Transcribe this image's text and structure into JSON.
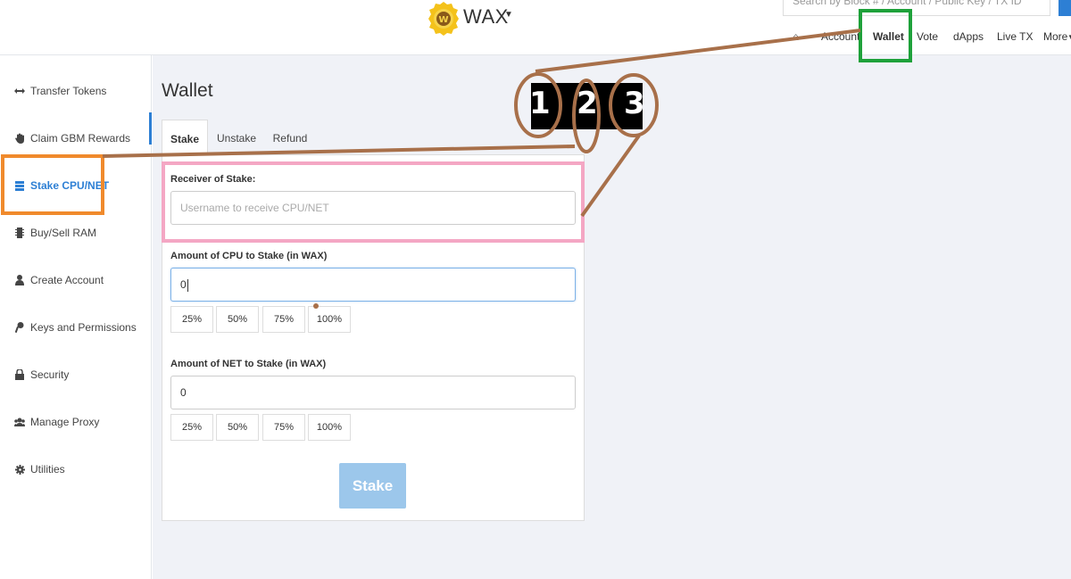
{
  "header": {
    "brand": "WAX",
    "search_placeholder": "Search by Block # / Account / Public Key / TX ID",
    "nav": {
      "account": "Account",
      "wallet": "Wallet",
      "vote": "Vote",
      "dapps": "dApps",
      "livetx": "Live TX",
      "more": "More"
    }
  },
  "sidebar": {
    "items": [
      {
        "label": "Transfer Tokens",
        "icon": "arrows-icon"
      },
      {
        "label": "Claim GBM Rewards",
        "icon": "hand-icon"
      },
      {
        "label": "Stake CPU/NET",
        "icon": "server-icon"
      },
      {
        "label": "Buy/Sell RAM",
        "icon": "chip-icon"
      },
      {
        "label": "Create Account",
        "icon": "user-icon"
      },
      {
        "label": "Keys and Permissions",
        "icon": "key-icon"
      },
      {
        "label": "Security",
        "icon": "lock-icon"
      },
      {
        "label": "Manage Proxy",
        "icon": "users-icon"
      },
      {
        "label": "Utilities",
        "icon": "gear-icon"
      }
    ]
  },
  "main": {
    "title": "Wallet",
    "tabs": [
      "Stake",
      "Unstake",
      "Refund"
    ],
    "form": {
      "receiver_label": "Receiver of Stake:",
      "receiver_placeholder": "Username to receive CPU/NET",
      "cpu_label": "Amount of CPU to Stake (in WAX)",
      "cpu_value": "0",
      "net_label": "Amount of NET to Stake (in WAX)",
      "net_value": "0",
      "percents": [
        "25%",
        "50%",
        "75%",
        "100%"
      ],
      "submit": "Stake"
    }
  },
  "annotations": {
    "numbers": [
      "1",
      "2",
      "3"
    ],
    "colors": {
      "line": "#a8704a",
      "sidebar_box": "#f08a2c",
      "wallet_box": "#1ea13a",
      "form_box": "#f4a7c4"
    }
  }
}
